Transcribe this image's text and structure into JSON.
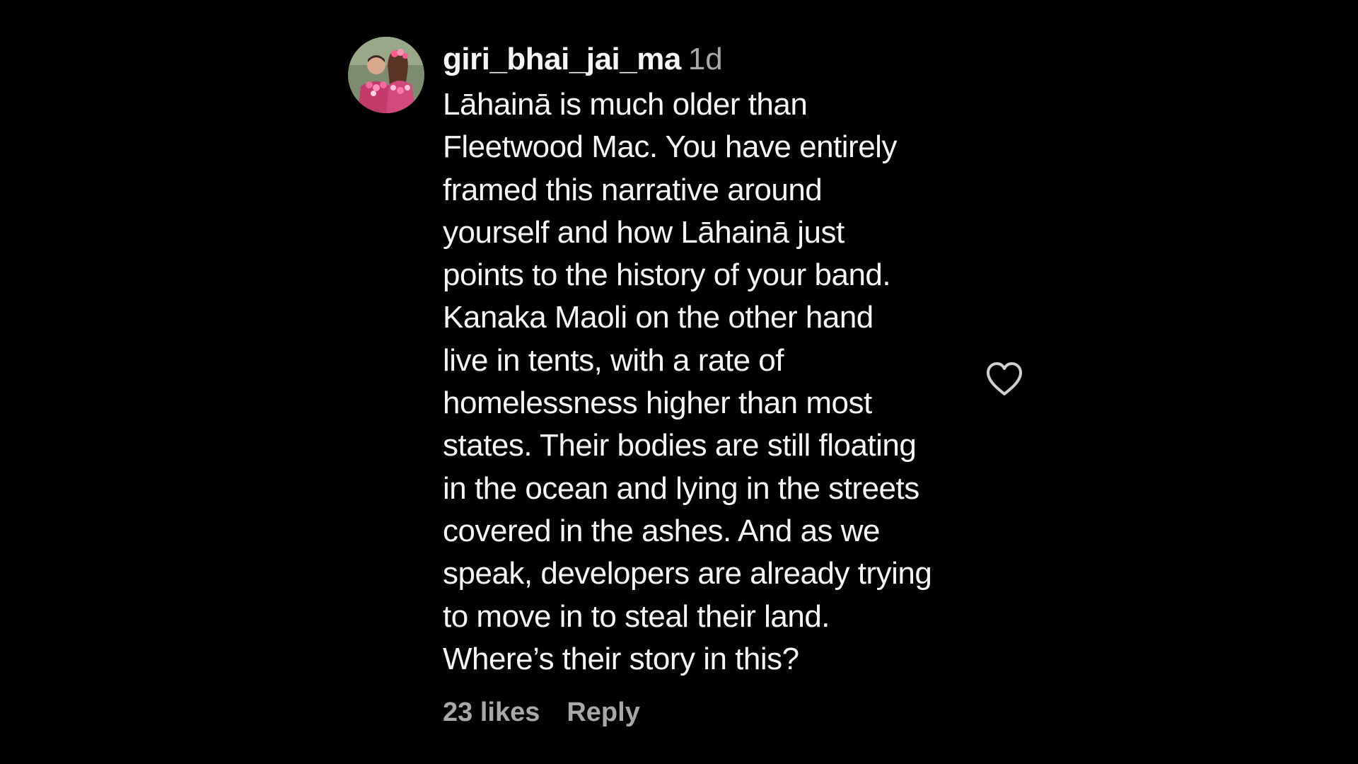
{
  "comment": {
    "username": "giri_bhai_jai_ma",
    "timestamp": "1d",
    "text_lines": [
      "Lāhainā is much older than",
      "Fleetwood Mac. You have entirely",
      "framed this narrative around",
      "yourself and how Lāhainā just",
      "points to the history of your band.",
      "Kanaka Maoli on the other hand",
      "live in tents, with a rate of",
      "homelessness higher than most",
      "states. Their bodies are still floating",
      "in the ocean and lying in the streets",
      "covered in the ashes. And as we",
      "speak, developers are already trying",
      "to move in to steal their land.",
      "Where’s their story in this?"
    ],
    "likes_label": "23 likes",
    "reply_label": "Reply",
    "avatar_icon": "profile-photo",
    "like_icon": "heart-outline-icon"
  },
  "colors": {
    "background": "#000000",
    "primary_text": "#f5f5f5",
    "secondary_text": "#a8a8a8"
  }
}
